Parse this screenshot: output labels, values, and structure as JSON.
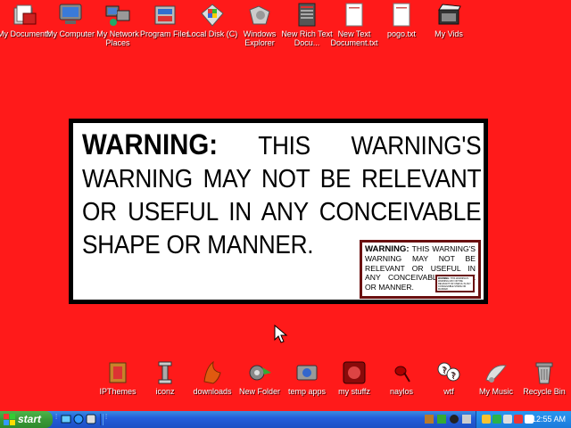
{
  "desktop": {
    "top_icons": [
      {
        "label": "My Documents",
        "icon": "my-documents-icon"
      },
      {
        "label": "My Computer",
        "icon": "my-computer-icon"
      },
      {
        "label": "My Network Places",
        "icon": "network-places-icon"
      },
      {
        "label": "Program Files",
        "icon": "program-files-icon"
      },
      {
        "label": "Local Disk (C)",
        "icon": "local-disk-icon"
      },
      {
        "label": "Windows Explorer",
        "icon": "windows-explorer-icon"
      },
      {
        "label": "New Rich Text Docu...",
        "icon": "rich-text-document-icon"
      },
      {
        "label": "New Text Document.txt",
        "icon": "text-document-icon"
      },
      {
        "label": "pogo.txt",
        "icon": "text-file-icon"
      },
      {
        "label": "My Vids",
        "icon": "my-vids-icon"
      }
    ],
    "bottom_icons": [
      {
        "label": "IPThemes",
        "icon": "ipthemes-icon"
      },
      {
        "label": "iconz",
        "icon": "iconz-icon"
      },
      {
        "label": "downloads",
        "icon": "downloads-icon"
      },
      {
        "label": "New Folder",
        "icon": "new-folder-icon"
      },
      {
        "label": "temp apps",
        "icon": "temp-apps-icon"
      },
      {
        "label": "my stuffz",
        "icon": "my-stuffz-icon"
      },
      {
        "label": "naylos",
        "icon": "naylos-icon"
      },
      {
        "label": "wtf",
        "icon": "wtf-icon"
      },
      {
        "label": "My Music",
        "icon": "my-music-icon"
      },
      {
        "label": "Recycle Bin",
        "icon": "recycle-bin-icon"
      }
    ]
  },
  "wallpaper": {
    "heading": "WARNING:",
    "body": "THIS WARNING'S WARNING MAY NOT BE RELEVANT OR USEFUL IN ANY CONCEIVABLE SHAPE OR MANNER.",
    "mini_heading": "WARNING:",
    "mini_body": "THIS WARNING'S WARNING MAY NOT BE RELEVANT OR USEFUL IN ANY CONCEIVABLE SHAPE OR MANNER."
  },
  "taskbar": {
    "start_label": "start",
    "clock": "12:55 AM"
  },
  "colors": {
    "desktop_bg": "#ff1a1a",
    "taskbar": "#245edb",
    "start_button": "#3a9a37"
  }
}
